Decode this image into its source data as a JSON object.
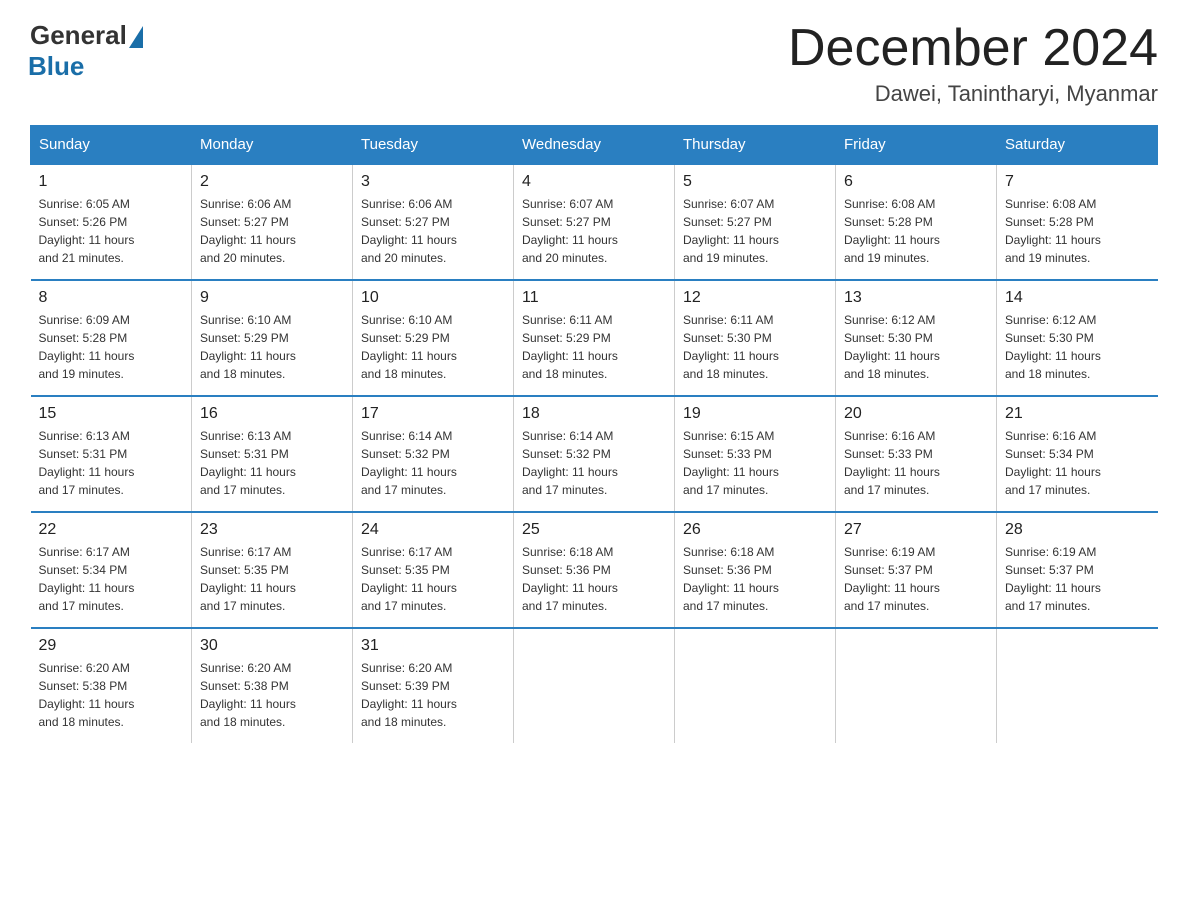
{
  "logo": {
    "general": "General",
    "blue": "Blue"
  },
  "title": "December 2024",
  "location": "Dawei, Tanintharyi, Myanmar",
  "headers": [
    "Sunday",
    "Monday",
    "Tuesday",
    "Wednesday",
    "Thursday",
    "Friday",
    "Saturday"
  ],
  "weeks": [
    [
      {
        "day": "1",
        "info": "Sunrise: 6:05 AM\nSunset: 5:26 PM\nDaylight: 11 hours\nand 21 minutes."
      },
      {
        "day": "2",
        "info": "Sunrise: 6:06 AM\nSunset: 5:27 PM\nDaylight: 11 hours\nand 20 minutes."
      },
      {
        "day": "3",
        "info": "Sunrise: 6:06 AM\nSunset: 5:27 PM\nDaylight: 11 hours\nand 20 minutes."
      },
      {
        "day": "4",
        "info": "Sunrise: 6:07 AM\nSunset: 5:27 PM\nDaylight: 11 hours\nand 20 minutes."
      },
      {
        "day": "5",
        "info": "Sunrise: 6:07 AM\nSunset: 5:27 PM\nDaylight: 11 hours\nand 19 minutes."
      },
      {
        "day": "6",
        "info": "Sunrise: 6:08 AM\nSunset: 5:28 PM\nDaylight: 11 hours\nand 19 minutes."
      },
      {
        "day": "7",
        "info": "Sunrise: 6:08 AM\nSunset: 5:28 PM\nDaylight: 11 hours\nand 19 minutes."
      }
    ],
    [
      {
        "day": "8",
        "info": "Sunrise: 6:09 AM\nSunset: 5:28 PM\nDaylight: 11 hours\nand 19 minutes."
      },
      {
        "day": "9",
        "info": "Sunrise: 6:10 AM\nSunset: 5:29 PM\nDaylight: 11 hours\nand 18 minutes."
      },
      {
        "day": "10",
        "info": "Sunrise: 6:10 AM\nSunset: 5:29 PM\nDaylight: 11 hours\nand 18 minutes."
      },
      {
        "day": "11",
        "info": "Sunrise: 6:11 AM\nSunset: 5:29 PM\nDaylight: 11 hours\nand 18 minutes."
      },
      {
        "day": "12",
        "info": "Sunrise: 6:11 AM\nSunset: 5:30 PM\nDaylight: 11 hours\nand 18 minutes."
      },
      {
        "day": "13",
        "info": "Sunrise: 6:12 AM\nSunset: 5:30 PM\nDaylight: 11 hours\nand 18 minutes."
      },
      {
        "day": "14",
        "info": "Sunrise: 6:12 AM\nSunset: 5:30 PM\nDaylight: 11 hours\nand 18 minutes."
      }
    ],
    [
      {
        "day": "15",
        "info": "Sunrise: 6:13 AM\nSunset: 5:31 PM\nDaylight: 11 hours\nand 17 minutes."
      },
      {
        "day": "16",
        "info": "Sunrise: 6:13 AM\nSunset: 5:31 PM\nDaylight: 11 hours\nand 17 minutes."
      },
      {
        "day": "17",
        "info": "Sunrise: 6:14 AM\nSunset: 5:32 PM\nDaylight: 11 hours\nand 17 minutes."
      },
      {
        "day": "18",
        "info": "Sunrise: 6:14 AM\nSunset: 5:32 PM\nDaylight: 11 hours\nand 17 minutes."
      },
      {
        "day": "19",
        "info": "Sunrise: 6:15 AM\nSunset: 5:33 PM\nDaylight: 11 hours\nand 17 minutes."
      },
      {
        "day": "20",
        "info": "Sunrise: 6:16 AM\nSunset: 5:33 PM\nDaylight: 11 hours\nand 17 minutes."
      },
      {
        "day": "21",
        "info": "Sunrise: 6:16 AM\nSunset: 5:34 PM\nDaylight: 11 hours\nand 17 minutes."
      }
    ],
    [
      {
        "day": "22",
        "info": "Sunrise: 6:17 AM\nSunset: 5:34 PM\nDaylight: 11 hours\nand 17 minutes."
      },
      {
        "day": "23",
        "info": "Sunrise: 6:17 AM\nSunset: 5:35 PM\nDaylight: 11 hours\nand 17 minutes."
      },
      {
        "day": "24",
        "info": "Sunrise: 6:17 AM\nSunset: 5:35 PM\nDaylight: 11 hours\nand 17 minutes."
      },
      {
        "day": "25",
        "info": "Sunrise: 6:18 AM\nSunset: 5:36 PM\nDaylight: 11 hours\nand 17 minutes."
      },
      {
        "day": "26",
        "info": "Sunrise: 6:18 AM\nSunset: 5:36 PM\nDaylight: 11 hours\nand 17 minutes."
      },
      {
        "day": "27",
        "info": "Sunrise: 6:19 AM\nSunset: 5:37 PM\nDaylight: 11 hours\nand 17 minutes."
      },
      {
        "day": "28",
        "info": "Sunrise: 6:19 AM\nSunset: 5:37 PM\nDaylight: 11 hours\nand 17 minutes."
      }
    ],
    [
      {
        "day": "29",
        "info": "Sunrise: 6:20 AM\nSunset: 5:38 PM\nDaylight: 11 hours\nand 18 minutes."
      },
      {
        "day": "30",
        "info": "Sunrise: 6:20 AM\nSunset: 5:38 PM\nDaylight: 11 hours\nand 18 minutes."
      },
      {
        "day": "31",
        "info": "Sunrise: 6:20 AM\nSunset: 5:39 PM\nDaylight: 11 hours\nand 18 minutes."
      },
      null,
      null,
      null,
      null
    ]
  ]
}
